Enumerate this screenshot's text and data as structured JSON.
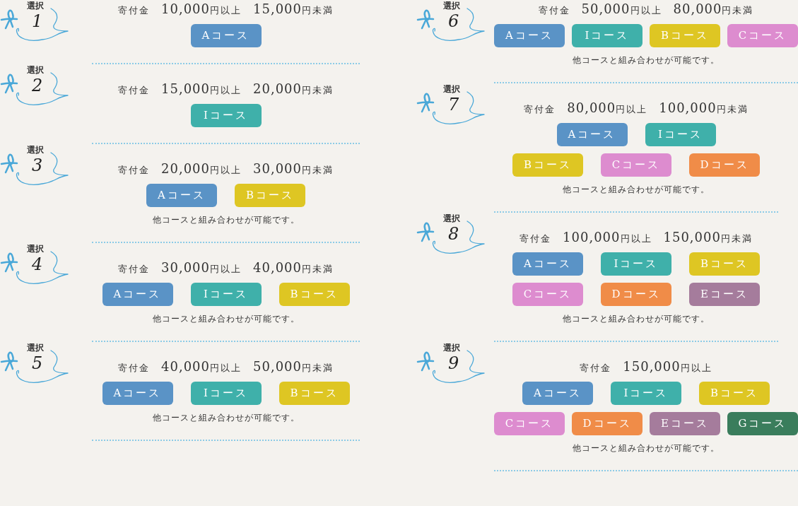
{
  "columns": [
    {
      "entries": [
        {
          "select_label": "選択",
          "number": "1",
          "donation_label": "寄付金",
          "lower_amount": "10,000",
          "lower_unit": "円以上",
          "upper_amount": "15,000",
          "upper_unit": "円未満",
          "course_rows": [
            [
              {
                "label": "Aコース",
                "color": "#5a93c6"
              }
            ]
          ]
        },
        {
          "select_label": "選択",
          "number": "2",
          "donation_label": "寄付金",
          "lower_amount": "15,000",
          "lower_unit": "円以上",
          "upper_amount": "20,000",
          "upper_unit": "円未満",
          "course_rows": [
            [
              {
                "label": "Iコース",
                "color": "#3fb0aa"
              }
            ]
          ]
        },
        {
          "select_label": "選択",
          "number": "3",
          "donation_label": "寄付金",
          "lower_amount": "20,000",
          "lower_unit": "円以上",
          "upper_amount": "30,000",
          "upper_unit": "円未満",
          "course_rows": [
            [
              {
                "label": "Aコース",
                "color": "#5a93c6"
              },
              {
                "label": "Bコース",
                "color": "#dec623"
              }
            ]
          ],
          "note": "他コースと組み合わせが可能です。"
        },
        {
          "select_label": "選択",
          "number": "4",
          "donation_label": "寄付金",
          "lower_amount": "30,000",
          "lower_unit": "円以上",
          "upper_amount": "40,000",
          "upper_unit": "円未満",
          "course_rows": [
            [
              {
                "label": "Aコース",
                "color": "#5a93c6"
              },
              {
                "label": "Iコース",
                "color": "#3fb0aa"
              },
              {
                "label": "Bコース",
                "color": "#dec623"
              }
            ]
          ],
          "note": "他コースと組み合わせが可能です。"
        },
        {
          "select_label": "選択",
          "number": "5",
          "donation_label": "寄付金",
          "lower_amount": "40,000",
          "lower_unit": "円以上",
          "upper_amount": "50,000",
          "upper_unit": "円未満",
          "course_rows": [
            [
              {
                "label": "Aコース",
                "color": "#5a93c6"
              },
              {
                "label": "Iコース",
                "color": "#3fb0aa"
              },
              {
                "label": "Bコース",
                "color": "#dec623"
              }
            ]
          ],
          "note": "他コースと組み合わせが可能です。"
        }
      ]
    },
    {
      "entries": [
        {
          "select_label": "選択",
          "number": "6",
          "donation_label": "寄付金",
          "lower_amount": "50,000",
          "lower_unit": "円以上",
          "upper_amount": "80,000",
          "upper_unit": "円未満",
          "course_rows": [
            [
              {
                "label": "Aコース",
                "color": "#5a93c6"
              },
              {
                "label": "Iコース",
                "color": "#3fb0aa"
              },
              {
                "label": "Bコース",
                "color": "#dec623"
              },
              {
                "label": "Cコース",
                "color": "#dd8ccf"
              }
            ]
          ],
          "note": "他コースと組み合わせが可能です。"
        },
        {
          "select_label": "選択",
          "number": "7",
          "donation_label": "寄付金",
          "lower_amount": "80,000",
          "lower_unit": "円以上",
          "upper_amount": "100,000",
          "upper_unit": "円未満",
          "course_rows": [
            [
              {
                "label": "Aコース",
                "color": "#5a93c6"
              },
              {
                "label": "Iコース",
                "color": "#3fb0aa"
              }
            ],
            [
              {
                "label": "Bコース",
                "color": "#dec623"
              },
              {
                "label": "Cコース",
                "color": "#dd8ccf"
              },
              {
                "label": "Dコース",
                "color": "#f08c48"
              }
            ]
          ],
          "note": "他コースと組み合わせが可能です。"
        },
        {
          "select_label": "選択",
          "number": "8",
          "donation_label": "寄付金",
          "lower_amount": "100,000",
          "lower_unit": "円以上",
          "upper_amount": "150,000",
          "upper_unit": "円未満",
          "course_rows": [
            [
              {
                "label": "Aコース",
                "color": "#5a93c6"
              },
              {
                "label": "Iコース",
                "color": "#3fb0aa"
              },
              {
                "label": "Bコース",
                "color": "#dec623"
              }
            ],
            [
              {
                "label": "Cコース",
                "color": "#dd8ccf"
              },
              {
                "label": "Dコース",
                "color": "#f08c48"
              },
              {
                "label": "Eコース",
                "color": "#a57c9c"
              }
            ]
          ],
          "note": "他コースと組み合わせが可能です。"
        },
        {
          "select_label": "選択",
          "number": "9",
          "donation_label": "寄付金",
          "lower_amount": "150,000",
          "lower_unit": "円以上",
          "course_rows": [
            [
              {
                "label": "Aコース",
                "color": "#5a93c6"
              },
              {
                "label": "Iコース",
                "color": "#3fb0aa"
              },
              {
                "label": "Bコース",
                "color": "#dec623"
              }
            ],
            [
              {
                "label": "Cコース",
                "color": "#dd8ccf"
              },
              {
                "label": "Dコース",
                "color": "#f08c48"
              },
              {
                "label": "Eコース",
                "color": "#a57c9c"
              },
              {
                "label": "Gコース",
                "color": "#3a7d5c"
              }
            ]
          ],
          "note": "他コースと組み合わせが可能です。"
        }
      ]
    }
  ]
}
